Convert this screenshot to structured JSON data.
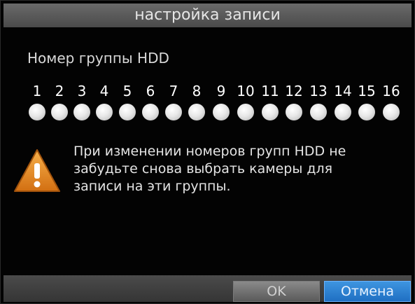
{
  "dialog": {
    "title": "настройка записи"
  },
  "hdd_group": {
    "label": "Номер группы HDD",
    "groups": [
      "1",
      "2",
      "3",
      "4",
      "5",
      "6",
      "7",
      "8",
      "9",
      "10",
      "11",
      "12",
      "13",
      "14",
      "15",
      "16"
    ]
  },
  "message": {
    "icon": "warning-icon",
    "lines": [
      "При изменении номеров групп HDD не",
      "забудьте снова выбрать камеры для",
      "записи на эти группы."
    ]
  },
  "buttons": {
    "ok": "OK",
    "cancel": "Отмена"
  },
  "colors": {
    "accent": "#2f84d6",
    "warning": "#e8891e"
  }
}
